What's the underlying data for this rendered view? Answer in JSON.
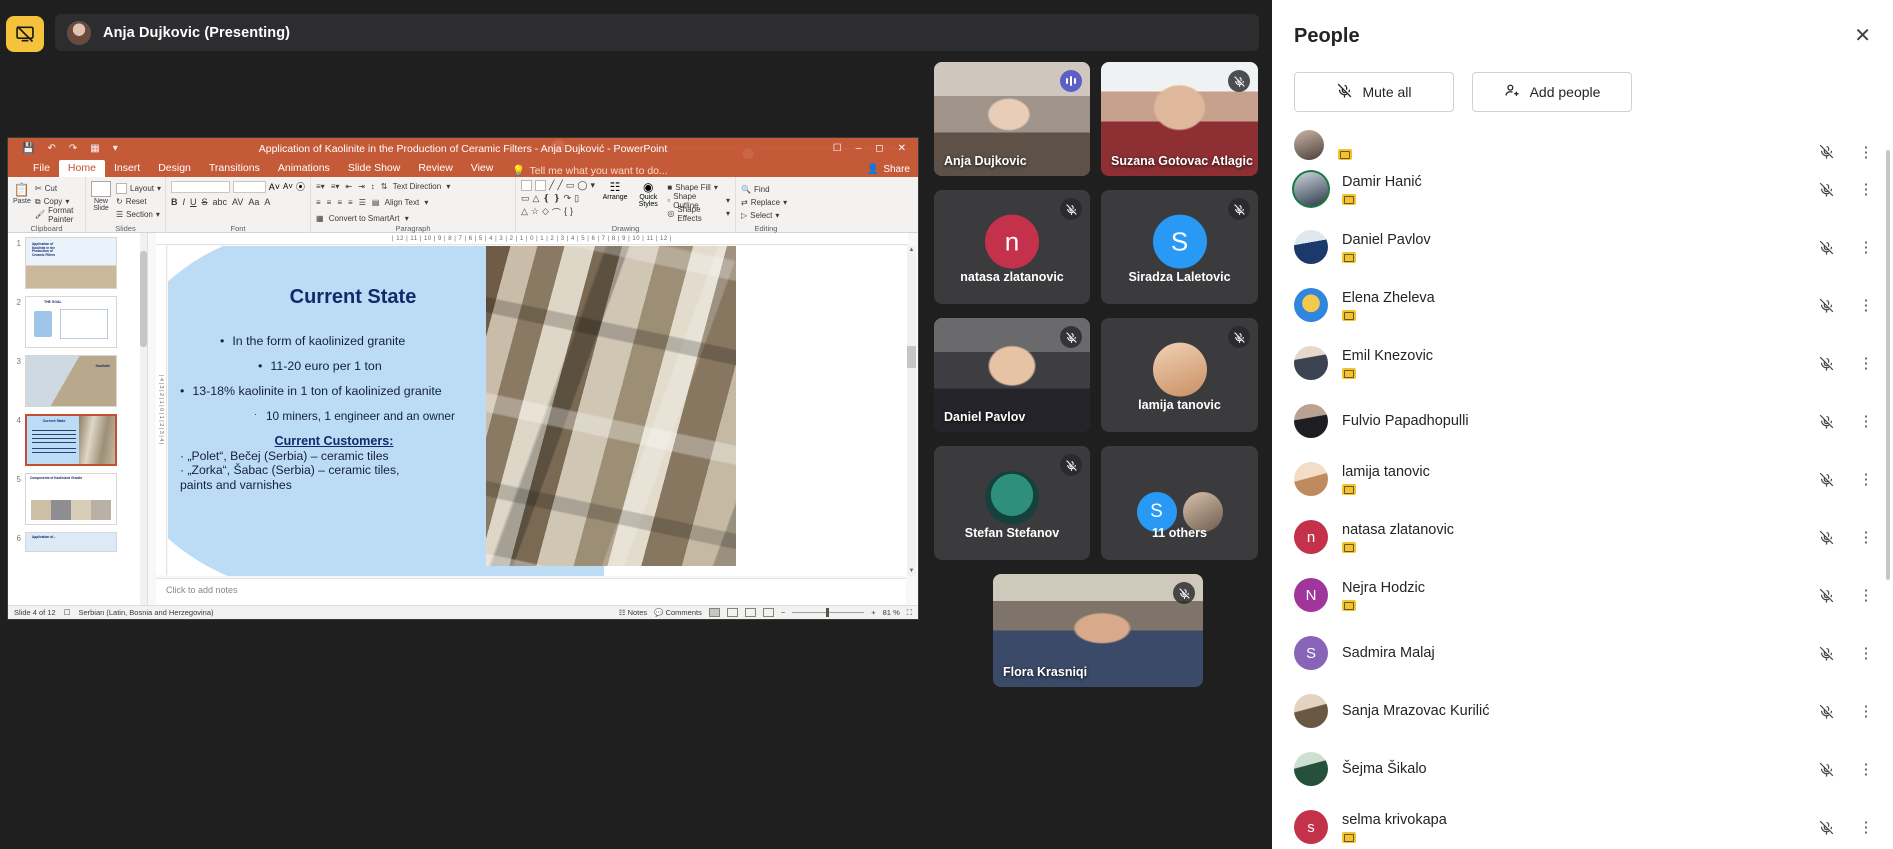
{
  "topbar": {
    "stop_share_icon": "stop-presenting-icon",
    "presenter_name": "Anja Dujkovic (Presenting)"
  },
  "powerpoint": {
    "title": "Application of Kaolinite in the Production of Ceramic Filters - Anja Dujković - PowerPoint",
    "quick_access": [
      "save-icon",
      "undo-icon",
      "redo-icon",
      "start-slideshow-icon",
      "customize-icon"
    ],
    "window_buttons": [
      "ribbon-display-options",
      "minimize",
      "restore",
      "close"
    ],
    "tabs": [
      "File",
      "Home",
      "Insert",
      "Design",
      "Transitions",
      "Animations",
      "Slide Show",
      "Review",
      "View"
    ],
    "active_tab": "Home",
    "tell_me": "Tell me what you want to do...",
    "share_label": "Share",
    "ribbon_groups": [
      {
        "name": "Clipboard",
        "items": [
          "Paste",
          "Cut",
          "Copy",
          "Format Painter"
        ]
      },
      {
        "name": "Slides",
        "items": [
          "New Slide",
          "Layout",
          "Reset",
          "Section"
        ]
      },
      {
        "name": "Font",
        "items": [
          "B",
          "I",
          "U",
          "S",
          "abc",
          "AV",
          "Aa",
          "A"
        ]
      },
      {
        "name": "Paragraph",
        "items": [
          "Text Direction",
          "Align Text",
          "Convert to SmartArt"
        ]
      },
      {
        "name": "Drawing",
        "items": [
          "Arrange",
          "Quick Styles",
          "Shape Fill",
          "Shape Outline",
          "Shape Effects"
        ]
      },
      {
        "name": "Editing",
        "items": [
          "Find",
          "Replace",
          "Select"
        ]
      }
    ],
    "ruler_h": "| 12 | 11 | 10 | 9 | 8 | 7 | 6 | 5 | 4 | 3 | 2 | 1 | 0 | 1 | 2 | 3 | 4 | 5 | 6 | 7 | 8 | 9 | 10 | 11 | 12 |",
    "ruler_v": "| 4 | 3 | 2 | 1 | 0 | 1 | 2 | 3 | 4 |",
    "notes_placeholder": "Click to add notes",
    "status": {
      "slide_counter": "Slide 4 of 12",
      "language": "Serbian (Latin, Bosnia and Herzegovina)",
      "notes_label": "Notes",
      "comments_label": "Comments",
      "zoom_level": "81 %"
    },
    "thumbnails": [
      {
        "number": "1",
        "title": "Application of Kaolinite in the Production of Ceramic Filters"
      },
      {
        "number": "2",
        "title": "THE GOAL"
      },
      {
        "number": "3",
        "title": "Kaolinite"
      },
      {
        "number": "4",
        "title": "Current State",
        "selected": true
      },
      {
        "number": "5",
        "title": "Components of Kaolinized Granite"
      },
      {
        "number": "6",
        "title": "Application of..."
      }
    ],
    "slide": {
      "title": "Current State",
      "bullets": [
        {
          "bullet": "•",
          "text": "In the form of kaolinized granite",
          "indent": 46
        },
        {
          "bullet": "•",
          "text": "11-20 euro per 1 ton",
          "indent": 84
        },
        {
          "bullet": "•",
          "text": "13-18% kaolinite in 1 ton of kaolinized granite",
          "indent": 6
        },
        {
          "bullet": "·",
          "text": "10 miners, 1 engineer and an owner",
          "indent": 80
        }
      ],
      "customers_heading": "Current Customers:",
      "customers": [
        "„Polet“, Bečej (Serbia) – ceramic tiles",
        "„Zorka“, Šabac (Serbia) – ceramic tiles,\npaints and varnishes"
      ]
    }
  },
  "video_tiles": [
    {
      "name": "Anja Dujkovic",
      "kind": "video",
      "speaking": true,
      "badge": "speaker-active-icon",
      "label_align": "left"
    },
    {
      "name": "Suzana Gotovac Atlagic",
      "kind": "video",
      "muted": true,
      "label_align": "left"
    },
    {
      "name": "natasa zlatanovic",
      "kind": "avatar",
      "initial": "n",
      "color": "#c4314b",
      "muted": true,
      "label_align": "center"
    },
    {
      "name": "Siradza Laletovic",
      "kind": "avatar",
      "initial": "S",
      "color": "#2899f5",
      "muted": true,
      "label_align": "center"
    },
    {
      "name": "Daniel Pavlov",
      "kind": "video",
      "muted": true,
      "label_align": "left"
    },
    {
      "name": "lamija tanovic",
      "kind": "video",
      "muted": true,
      "label_align": "center"
    },
    {
      "name": "Stefan Stefanov",
      "kind": "video",
      "muted": true,
      "label_align": "center"
    },
    {
      "name": "11 others",
      "kind": "overflow",
      "initial": "S",
      "color": "#2899f5",
      "label_align": "center"
    },
    {
      "name": "Flora Krasniqi",
      "kind": "video",
      "muted": true,
      "label_align": "left"
    }
  ],
  "people_panel": {
    "title": "People",
    "close_icon": "close-icon",
    "mute_all_label": "Mute all",
    "mute_all_icon": "mic-off-icon",
    "add_people_label": "Add people",
    "add_people_icon": "add-person-icon",
    "participants": [
      {
        "name": "",
        "initial": "",
        "color": "#8b8b8b",
        "photo": true,
        "flag": true,
        "muted": true,
        "partial": true
      },
      {
        "name": "Damir Hanić",
        "color": "#1b7a43",
        "photo": true,
        "flag": true,
        "muted": true
      },
      {
        "name": "Daniel Pavlov",
        "color": "#1b3a6b",
        "photo": true,
        "flag": true,
        "muted": true
      },
      {
        "name": "Elena Zheleva",
        "color": "#e8a33d",
        "photo": true,
        "flag": true,
        "muted": true
      },
      {
        "name": "Emil Knezovic",
        "color": "#4b5563",
        "photo": true,
        "flag": true,
        "muted": true
      },
      {
        "name": "Fulvio Papadhopulli",
        "color": "#2b2b33",
        "photo": true,
        "flag": false,
        "muted": true
      },
      {
        "name": "lamija tanovic",
        "color": "#d8a37a",
        "photo": true,
        "flag": true,
        "muted": true
      },
      {
        "name": "natasa zlatanovic",
        "initial": "n",
        "color": "#c4314b",
        "flag": true,
        "muted": true
      },
      {
        "name": "Nejra Hodzic",
        "initial": "N",
        "color": "#a0359b",
        "flag": true,
        "muted": true
      },
      {
        "name": "Sadmira Malaj",
        "initial": "S",
        "color": "#8764b8",
        "flag": false,
        "muted": true
      },
      {
        "name": "Sanja Mrazovac Kurilić",
        "color": "#9a7b55",
        "photo": true,
        "flag": false,
        "muted": true
      },
      {
        "name": "Šejma Šikalo",
        "color": "#2f6f4f",
        "photo": true,
        "flag": false,
        "muted": true
      },
      {
        "name": "selma krivokapa",
        "initial": "s",
        "color": "#c4314b",
        "flag": true,
        "muted": true
      }
    ]
  }
}
